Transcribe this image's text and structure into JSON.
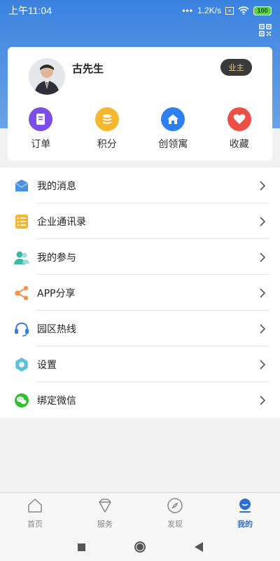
{
  "status_bar": {
    "time": "上午11:04",
    "network_speed": "1.2K/s",
    "battery": "100"
  },
  "profile": {
    "name": "古先生",
    "role_badge": "业主"
  },
  "quick_actions": [
    {
      "label": "订单",
      "icon": "order-icon",
      "color": "#7b4ee6"
    },
    {
      "label": "积分",
      "icon": "points-icon",
      "color": "#f5b72d"
    },
    {
      "label": "创领寓",
      "icon": "home-icon",
      "color": "#2e7ff0"
    },
    {
      "label": "收藏",
      "icon": "heart-icon",
      "color": "#ec4f45"
    }
  ],
  "menu": [
    {
      "label": "我的消息",
      "icon": "message-icon",
      "color": "#4a90e2"
    },
    {
      "label": "企业通讯录",
      "icon": "contacts-icon",
      "color": "#f5b331"
    },
    {
      "label": "我的参与",
      "icon": "participation-icon",
      "color": "#3db8a8"
    },
    {
      "label": "APP分享",
      "icon": "share-icon",
      "color": "#f39452"
    },
    {
      "label": "园区热线",
      "icon": "hotline-icon",
      "color": "#3a7de0"
    },
    {
      "label": "设置",
      "icon": "settings-icon",
      "color": "#5ec2d6"
    },
    {
      "label": "绑定微信",
      "icon": "wechat-icon",
      "color": "#2ec22e"
    }
  ],
  "tabs": [
    {
      "label": "首页",
      "icon": "home-tab-icon",
      "active": false
    },
    {
      "label": "服务",
      "icon": "service-tab-icon",
      "active": false
    },
    {
      "label": "发现",
      "icon": "discover-tab-icon",
      "active": false
    },
    {
      "label": "我的",
      "icon": "profile-tab-icon",
      "active": true
    }
  ],
  "colors": {
    "header_gradient_top": "#3b82df",
    "header_gradient_bottom": "#6aa3e6",
    "active_tab": "#2b6fd6",
    "badge_bg": "#3a3a3a",
    "badge_text": "#e8c98a"
  }
}
